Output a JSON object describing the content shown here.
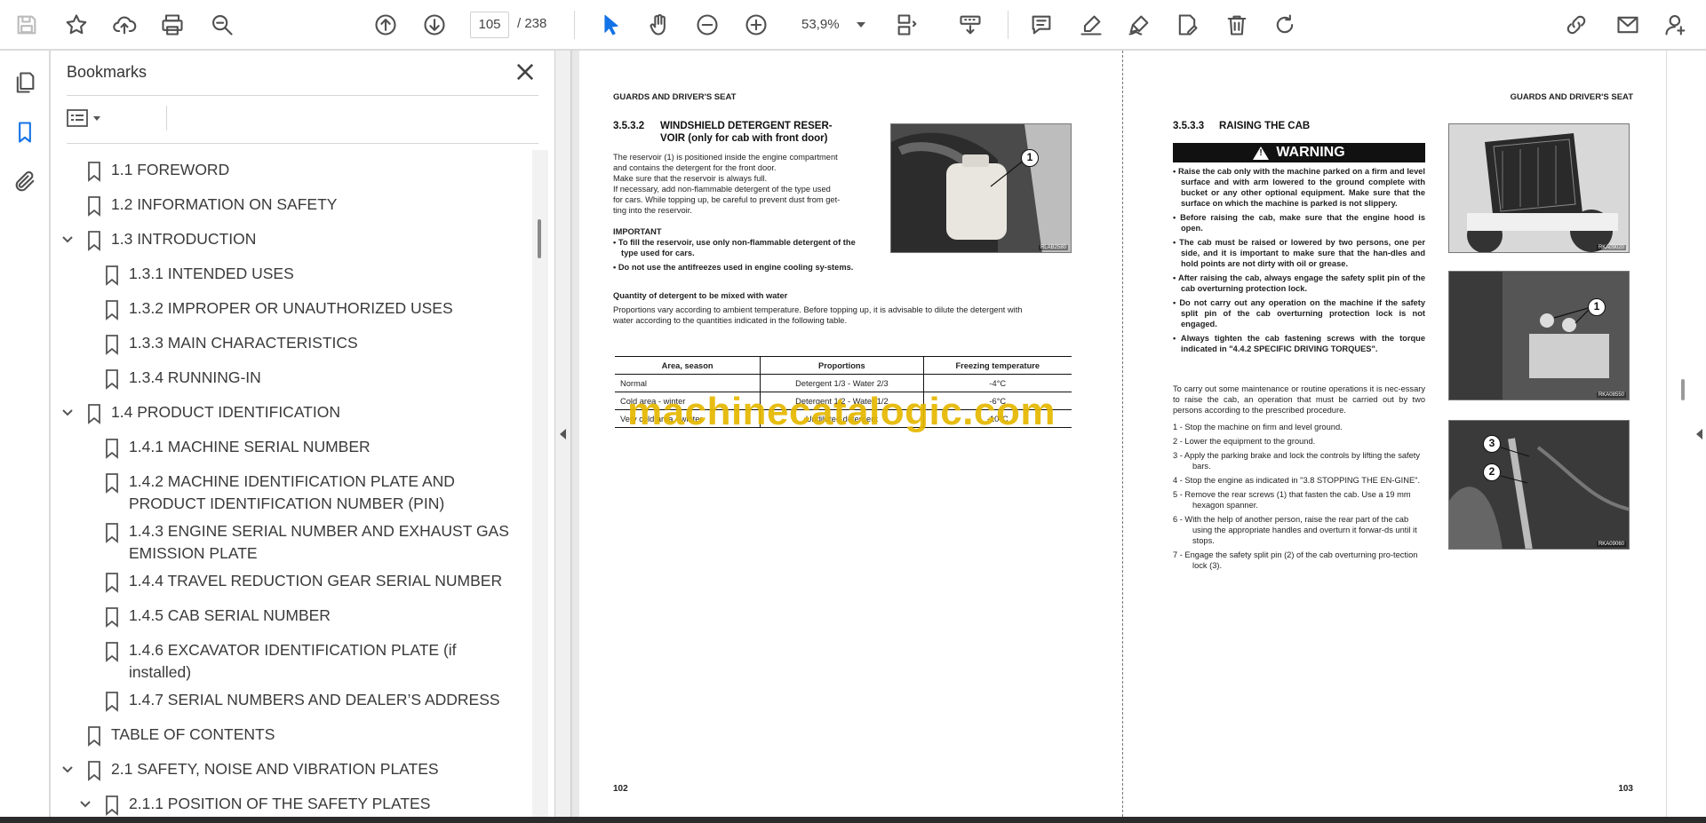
{
  "toolbar": {
    "page_current": "105",
    "page_total": "/  238",
    "zoom": "53,9%"
  },
  "panel": {
    "title": "Bookmarks"
  },
  "bookmarks": [
    {
      "label": "1.1 FOREWORD",
      "level": 1,
      "expanded": null
    },
    {
      "label": "1.2 INFORMATION ON SAFETY",
      "level": 1,
      "expanded": null
    },
    {
      "label": "1.3 INTRODUCTION",
      "level": 1,
      "expanded": true
    },
    {
      "label": "1.3.1 INTENDED USES",
      "level": 2,
      "expanded": null
    },
    {
      "label": "1.3.2 IMPROPER OR UNAUTHORIZED USES",
      "level": 2,
      "expanded": null
    },
    {
      "label": "1.3.3 MAIN CHARACTERISTICS",
      "level": 2,
      "expanded": null
    },
    {
      "label": "1.3.4 RUNNING-IN",
      "level": 2,
      "expanded": null
    },
    {
      "label": "1.4 PRODUCT IDENTIFICATION",
      "level": 1,
      "expanded": true
    },
    {
      "label": "1.4.1 MACHINE SERIAL NUMBER",
      "level": 2,
      "expanded": null
    },
    {
      "label": "1.4.2 MACHINE IDENTIFICATION PLATE AND PRODUCT IDENTIFICATION NUMBER (PIN)",
      "level": 2,
      "expanded": null
    },
    {
      "label": "1.4.3 ENGINE SERIAL NUMBER AND EXHAUST GAS EMISSION PLATE",
      "level": 2,
      "expanded": null
    },
    {
      "label": "1.4.4 TRAVEL REDUCTION GEAR SERIAL NUMBER",
      "level": 2,
      "expanded": null
    },
    {
      "label": "1.4.5 CAB SERIAL NUMBER",
      "level": 2,
      "expanded": null
    },
    {
      "label": "1.4.6 EXCAVATOR IDENTIFICATION PLATE (if installed)",
      "level": 2,
      "expanded": null
    },
    {
      "label": "1.4.7 SERIAL NUMBERS AND DEALER’S ADDRESS",
      "level": 2,
      "expanded": null
    },
    {
      "label": "TABLE OF CONTENTS",
      "level": 1,
      "expanded": null
    },
    {
      "label": "2.1 SAFETY, NOISE AND VIBRATION PLATES",
      "level": 1,
      "expanded": true
    },
    {
      "label": "2.1.1 POSITION OF THE SAFETY PLATES",
      "level": 2,
      "expanded": true
    }
  ],
  "left_page": {
    "header": "GUARDS AND DRIVER'S SEAT",
    "section_num": "3.5.3.2",
    "section_title_1": "WINDSHIELD DETERGENT RESER-",
    "section_title_2": "VOIR (only for cab with front door)",
    "intro_1": "The reservoir (1) is positioned inside the engine compartment",
    "intro_2": "and contains the detergent for the front door.",
    "intro_3": "Make sure that the reservoir is always full.",
    "intro_4": "If necessary, add non-flammable detergent of the type used",
    "intro_5": "for cars. While topping up, be careful to prevent dust from get-",
    "intro_6": "ting into the reservoir.",
    "important_label": "IMPORTANT",
    "important_1": "• To fill the reservoir, use only non-flammable detergent of the type used for cars.",
    "important_2": "• Do not use the antifreezes used in engine cooling sy-stems.",
    "qty_heading": "Quantity of detergent to be mixed with water",
    "qty_text_1": "Proportions vary according to ambient temperature. Before topping up, it is advisable to dilute the detergent with",
    "qty_text_2": "water according to the quantities indicated in the following table.",
    "photo_code": "RLAB2580",
    "callout_1": "1",
    "table": {
      "headers": [
        "Area, season",
        "Proportions",
        "Freezing temperature"
      ],
      "rows": [
        [
          "Normal",
          "Detergent 1/3 - Water 2/3",
          "-4°C"
        ],
        [
          "Cold area - winter",
          "Detergent 1/2 - Water 1/2",
          "-6°C"
        ],
        [
          "Very cold area - winter",
          "Undiluted detergent",
          "-10°C"
        ]
      ]
    },
    "page_number": "102"
  },
  "right_page": {
    "header": "GUARDS AND DRIVER'S SEAT",
    "section_num": "3.5.3.3",
    "section_title": "RAISING THE CAB",
    "warning_label": "WARNING",
    "warnings": [
      "Raise the cab only with the machine parked on a firm and level surface and with arm lowered to the ground complete with bucket or any other optional equipment. Make sure that the surface on which the machine is parked is not slippery.",
      "Before raising the cab, make sure that the engine hood is open.",
      "The cab must be raised or lowered by two persons, one per side, and it is important to make sure that the han-dles and hold points are not dirty with oil or grease.",
      "After raising the cab, always engage the safety split pin of the cab overturning protection lock.",
      "Do not carry out any operation on the machine if the safety split pin of the cab overturning protection lock is not engaged.",
      "Always tighten the cab fastening screws with the torque indicated in \"4.4.2 SPECIFIC DRIVING TORQUES\"."
    ],
    "intro": "To carry out some maintenance or routine operations it is nec-essary to raise the cab, an operation that must be carried out by two persons according to the prescribed procedure.",
    "steps": [
      "1 -   Stop the machine on firm and level ground.",
      "2 -   Lower the equipment to the ground.",
      "3 -   Apply the parking brake and lock the controls by lifting the safety bars.",
      "4 -   Stop the engine as indicated in \"3.8 STOPPING THE EN-GINE\".",
      "5 -   Remove the rear screws (1) that fasten the cab. Use a 19 mm hexagon spanner.",
      "6 -   With the help of another person, raise the rear part of the cab using the appropriate handles and overturn it forwar-ds until it stops.",
      "7 -   Engage the safety split pin (2) of the cab overturning pro-tection lock (3)."
    ],
    "photo1_code": "RKA09020",
    "photo2_code": "RKA08550",
    "photo3_code": "RKA09060",
    "callout_p2": "1",
    "callout_p3a": "3",
    "callout_p3b": "2",
    "page_number": "103"
  },
  "watermark": "machinecatalogic.com"
}
